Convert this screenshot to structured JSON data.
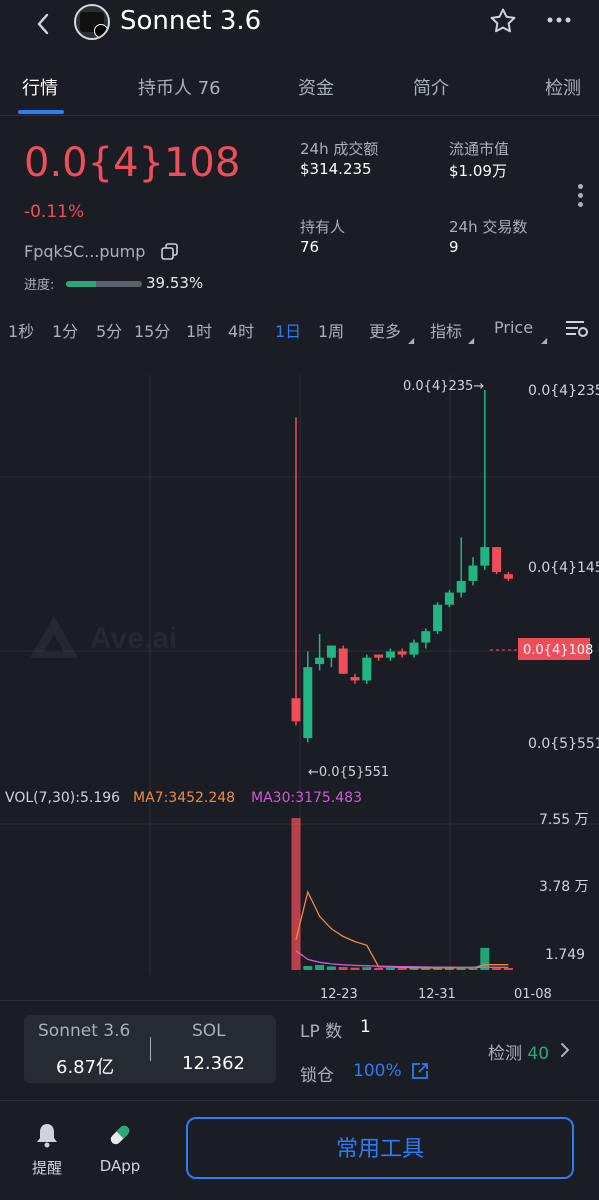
{
  "header": {
    "back_icon": "chevron-left-icon",
    "title": "Sonnet 3.6",
    "star_icon": "star-outline-icon",
    "more_icon": "more-horizontal-icon"
  },
  "tabs": [
    {
      "label": "行情",
      "active": true
    },
    {
      "label": "持币人 76",
      "active": false
    },
    {
      "label": "资金",
      "active": false
    },
    {
      "label": "简介",
      "active": false
    },
    {
      "label": "检测",
      "active": false
    }
  ],
  "token": {
    "price": "0.0{4}108",
    "change": "-0.11%",
    "address": "FpqkSC...pump",
    "progress_label": "进度:",
    "progress_pct": "39.53%",
    "progress_value": 0.3953
  },
  "stats": {
    "volume_label": "24h 成交额",
    "volume_value": "$314.235",
    "mcap_label": "流通市值",
    "mcap_value": "$1.09万",
    "holders_label": "持有人",
    "holders_value": "76",
    "txns_label": "24h 交易数",
    "txns_value": "9"
  },
  "intervals": [
    {
      "label": "1秒",
      "active": false
    },
    {
      "label": "1分",
      "active": false
    },
    {
      "label": "5分",
      "active": false
    },
    {
      "label": "15分",
      "active": false
    },
    {
      "label": "1时",
      "active": false
    },
    {
      "label": "4时",
      "active": false
    },
    {
      "label": "1日",
      "active": true
    },
    {
      "label": "1周",
      "active": false
    },
    {
      "label": "更多",
      "active": false
    },
    {
      "label": "指标",
      "active": false
    },
    {
      "label": "Price",
      "active": false
    }
  ],
  "chart": {
    "watermark": "Ave.ai",
    "price_axis": [
      "0.0{4}235",
      "0.0{4}145",
      "0.0{5}551"
    ],
    "current_price_tag": "0.0{4}108",
    "max_annotation": "0.0{4}235→",
    "min_annotation": "←0.0{5}551",
    "vol_label": "VOL(7,30):5.196",
    "ma7_label": "MA7:3452.248",
    "ma30_label": "MA30:3175.483",
    "vol_axis": [
      "7.55 万",
      "3.78 万",
      "1.749"
    ],
    "x_axis": [
      "12-23",
      "12-31",
      "01-08"
    ],
    "colors": {
      "up": "#22b482",
      "down": "#f04d5a",
      "ma7": "#f08a3e",
      "ma30": "#d25ad8"
    }
  },
  "chart_data": {
    "type": "candlestick",
    "x_labels": [
      "12-23",
      "12-31",
      "01-08"
    ],
    "candles": [
      {
        "o": 6.6e-06,
        "h": 2.1e-05,
        "l": 5.9e-06,
        "c": 6e-06
      },
      {
        "o": 5.6e-06,
        "h": 8e-06,
        "l": 5.5e-06,
        "c": 7.5e-06
      },
      {
        "o": 7.6e-06,
        "h": 8.6e-06,
        "l": 7.4e-06,
        "c": 7.8e-06
      },
      {
        "o": 7.8e-06,
        "h": 8.1e-06,
        "l": 7.5e-06,
        "c": 8.2e-06
      },
      {
        "o": 8.1e-06,
        "h": 8.2e-06,
        "l": 7.3e-06,
        "c": 7.3e-06
      },
      {
        "o": 7.2e-06,
        "h": 7.3e-06,
        "l": 7e-06,
        "c": 7.1e-06
      },
      {
        "o": 7.1e-06,
        "h": 7.9e-06,
        "l": 7e-06,
        "c": 7.8e-06
      },
      {
        "o": 7.9e-06,
        "h": 7.9e-06,
        "l": 7.7e-06,
        "c": 7.8e-06
      },
      {
        "o": 7.8e-06,
        "h": 8.1e-06,
        "l": 7.7e-06,
        "c": 8e-06
      },
      {
        "o": 8e-06,
        "h": 8.1e-06,
        "l": 7.8e-06,
        "c": 7.9e-06
      },
      {
        "o": 7.9e-06,
        "h": 8.4e-06,
        "l": 7.8e-06,
        "c": 8.3e-06
      },
      {
        "o": 8.3e-06,
        "h": 8.8e-06,
        "l": 8.1e-06,
        "c": 8.7e-06
      },
      {
        "o": 8.7e-06,
        "h": 9.8e-06,
        "l": 8.6e-06,
        "c": 9.7e-06
      },
      {
        "o": 9.7e-06,
        "h": 1.03e-05,
        "l": 9.6e-06,
        "c": 1.02e-05
      },
      {
        "o": 1.02e-05,
        "h": 1.28e-05,
        "l": 1e-05,
        "c": 1.07e-05
      },
      {
        "o": 1.07e-05,
        "h": 1.18e-05,
        "l": 1.05e-05,
        "c": 1.14e-05
      },
      {
        "o": 1.14e-05,
        "h": 2.35e-05,
        "l": 1.12e-05,
        "c": 1.23e-05
      },
      {
        "o": 1.23e-05,
        "h": 1.23e-05,
        "l": 1.1e-05,
        "c": 1.11e-05
      },
      {
        "o": 1.1e-05,
        "h": 1.11e-05,
        "l": 1.07e-05,
        "c": 1.08e-05
      }
    ],
    "volume": [
      75500,
      2000,
      2500,
      1800,
      1500,
      1200,
      1400,
      1000,
      1100,
      1000,
      900,
      1200,
      1000,
      1500,
      1300,
      1200,
      11000,
      1500,
      800
    ],
    "vol_ylim": [
      0,
      75500
    ]
  },
  "bottom": {
    "pair_left_label": "Sonnet 3.6",
    "pair_left_value": "6.87亿",
    "pair_right_label": "SOL",
    "pair_right_value": "12.362",
    "lp_label": "LP 数",
    "lp_value": "1",
    "lock_label": "锁仓",
    "lock_value": "100%",
    "detect_label": "检测",
    "detect_value": "40"
  },
  "footer": {
    "alert_label": "提醒",
    "dapp_label": "DApp",
    "tools_label": "常用工具"
  }
}
